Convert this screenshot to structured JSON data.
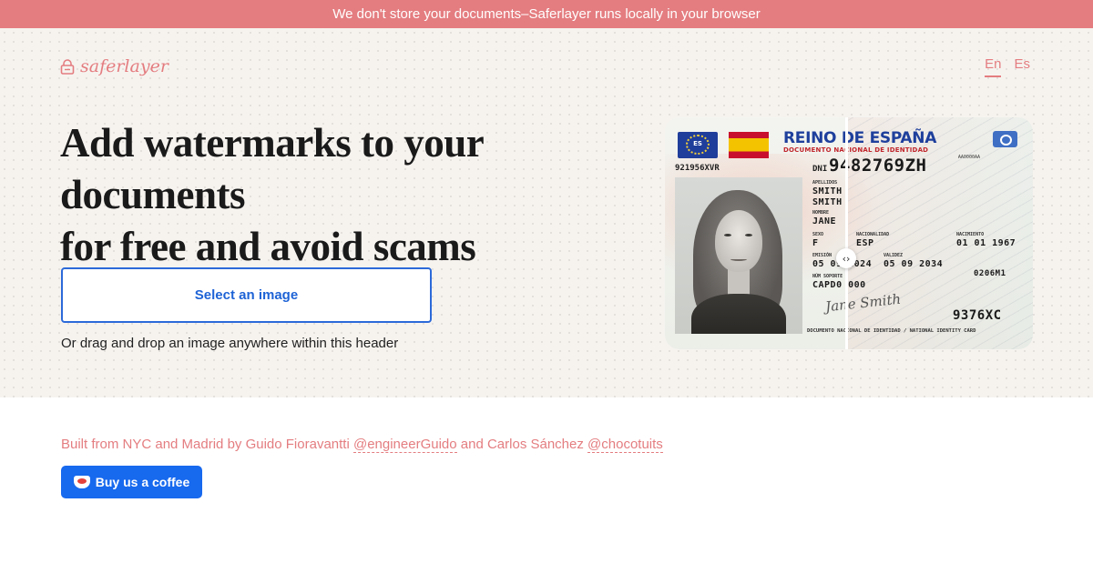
{
  "banner": {
    "text": "We don't store your documents–Saferlayer runs locally in your browser"
  },
  "header": {
    "logo_text": "saferlayer",
    "logo_icon": "lock-icon",
    "languages": [
      "En",
      "Es"
    ],
    "active_language": "En"
  },
  "hero": {
    "headline_line1": "Add watermarks to your documents",
    "headline_line2": "for free and avoid scams",
    "select_button": "Select an image",
    "drag_note": "Or drag and drop an image anywhere within this header"
  },
  "id_card": {
    "country_code": "ES",
    "title": "REINO DE ESPAÑA",
    "subtitle": "DOCUMENTO NACIONAL DE IDENTIDAD",
    "serial": "921956XVR",
    "small_code": "AA0000AA",
    "dni_label": "DNI",
    "dni_number": "9482769ZH",
    "labels": {
      "surnames": "APELLIDOS",
      "name": "NOMBRE",
      "sex": "SEXO",
      "nationality": "NACIONALIDAD",
      "birth": "NACIMIENTO",
      "issue": "EMISIÓN",
      "validity": "VALIDEZ",
      "support": "NÚM SOPORTE"
    },
    "surname1": "SMITH",
    "surname2": "SMITH",
    "name": "JANE",
    "sex": "F",
    "nationality": "ESP",
    "birth_date": "01 01 1967",
    "issue_date": "05 09 2024",
    "expiry_date": "05 09 2034",
    "support_number": "CAPD0 000",
    "code": "0206M1",
    "can": "9376XC",
    "signature": "Jane Smith",
    "footer": "DOCUMENTO NACIONAL DE IDENTIDAD / NATIONAL IDENTITY CARD",
    "slider_glyph": "‹›"
  },
  "credits": {
    "prefix": "Built from NYC and Madrid by Guido Fioravantti",
    "handle1": "@engineerGuido",
    "middle": "and Carlos Sánchez",
    "handle2": "@chocotuits"
  },
  "coffee_button": {
    "label": "Buy us a coffee",
    "icon": "coffee-cup-icon"
  },
  "colors": {
    "accent": "#e47d80",
    "primary": "#1769ee",
    "background": "#f6f3ef"
  }
}
